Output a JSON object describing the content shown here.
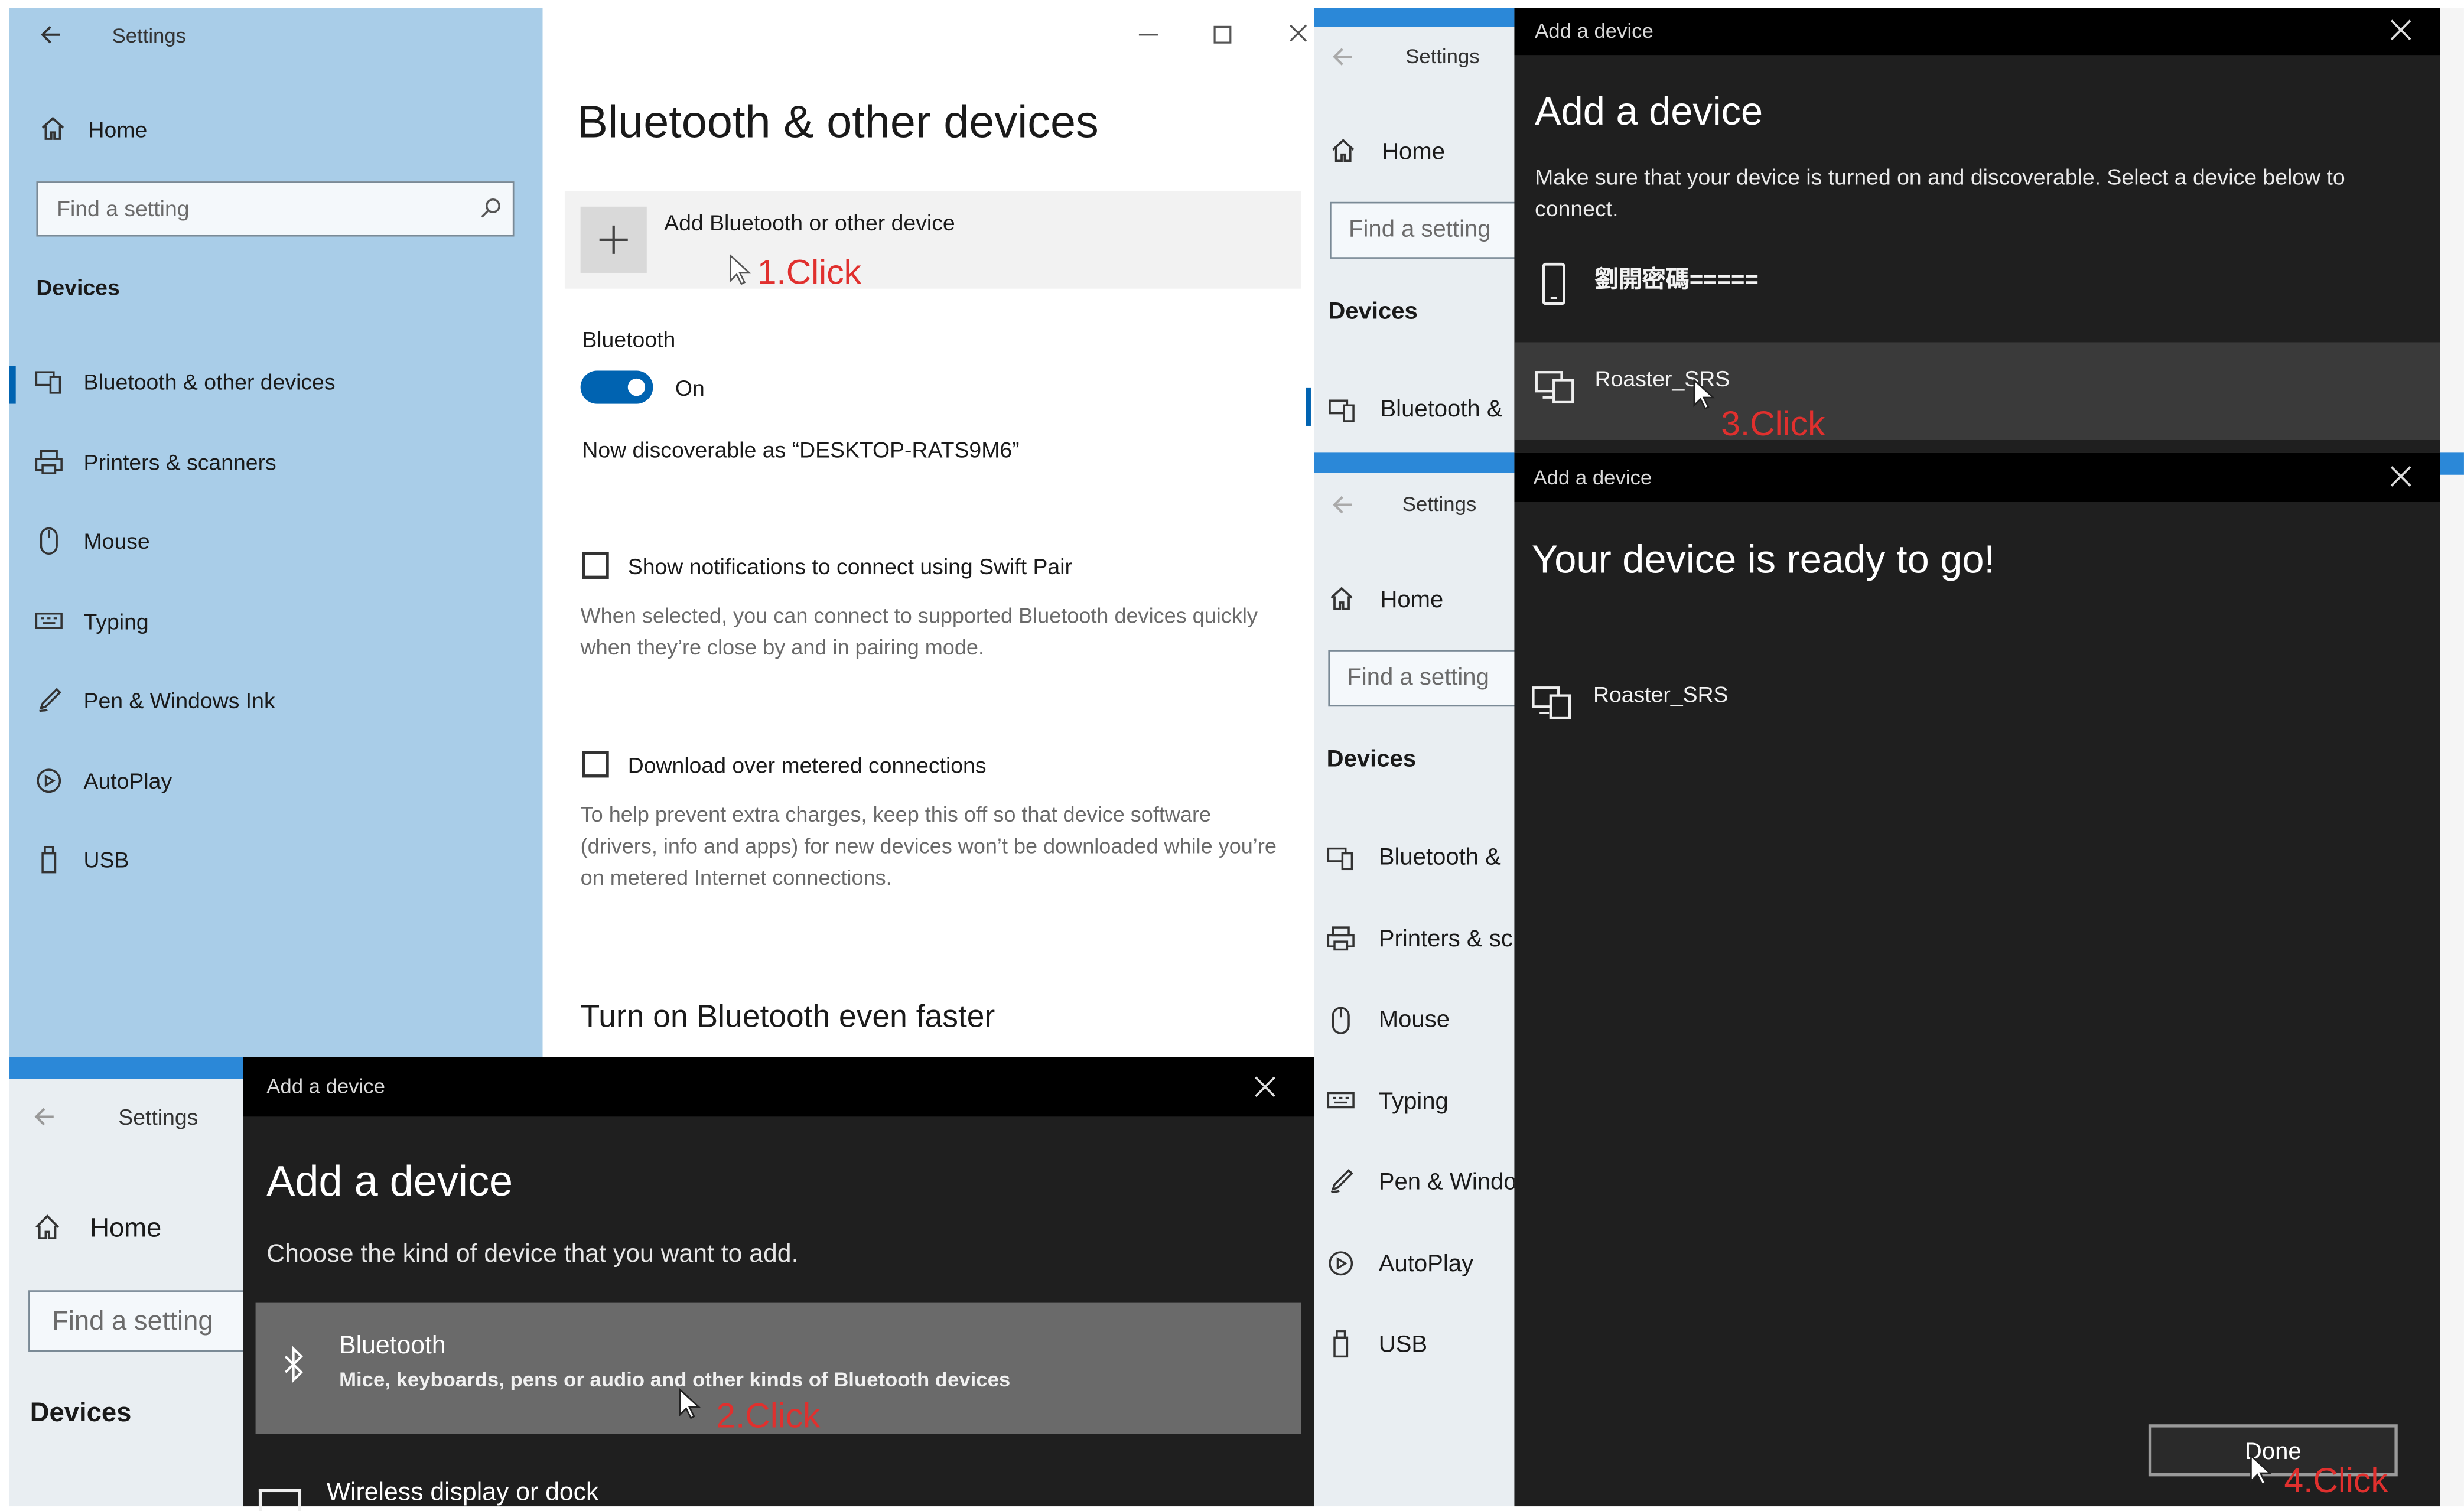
{
  "win1": {
    "title": "Settings",
    "home": "Home",
    "search_placeholder": "Find a setting",
    "section": "Devices",
    "nav": [
      "Bluetooth & other devices",
      "Printers & scanners",
      "Mouse",
      "Typing",
      "Pen & Windows Ink",
      "AutoPlay",
      "USB"
    ],
    "page_title": "Bluetooth & other devices",
    "add_label": "Add Bluetooth or other device",
    "click1": "1.Click",
    "bt_label": "Bluetooth",
    "bt_state": "On",
    "discoverable": "Now discoverable as “DESKTOP-RATS9M6”",
    "swift_label": "Show notifications to connect using Swift Pair",
    "swift_desc": "When selected, you can connect to supported Bluetooth devices quickly when they’re close by and in pairing mode.",
    "metered_label": "Download over metered connections",
    "metered_desc": "To help prevent extra charges, keep this off so that device software (drivers, info and apps) for new devices won’t be downloaded while you’re on metered Internet connections.",
    "faster": "Turn on Bluetooth even faster"
  },
  "win2": {
    "title": "Settings",
    "home": "Home",
    "search_placeholder": "Find a setting",
    "section": "Devices",
    "dialog_title": "Add a device",
    "heading": "Add a device",
    "subtitle": "Choose the kind of device that you want to add.",
    "option1_title": "Bluetooth",
    "option1_desc": "Mice, keyboards, pens or audio and other kinds of Bluetooth devices",
    "click2": "2.Click",
    "option2_title": "Wireless display or dock"
  },
  "win3": {
    "title": "Settings",
    "home": "Home",
    "search_placeholder": "Find a setting",
    "section": "Devices",
    "nav0": "Bluetooth &",
    "dialog_title": "Add a device",
    "heading": "Add a device",
    "desc": "Make sure that your device is turned on and discoverable. Select a device below to connect.",
    "device1": "劉開密碼=====",
    "device2": "Roaster_SRS",
    "click3": "3.Click"
  },
  "win4": {
    "title": "Settings",
    "home": "Home",
    "search_placeholder": "Find a setting",
    "section": "Devices",
    "nav": [
      "Bluetooth &",
      "Printers & sc",
      "Mouse",
      "Typing",
      "Pen & Windo",
      "AutoPlay",
      "USB"
    ],
    "dialog_title": "Add a device",
    "heading": "Your device is ready to go!",
    "device": "Roaster_SRS",
    "done": "Done",
    "click4": "4.Click"
  },
  "colors": {
    "accent": "#0063b1",
    "annotation": "#e0302e",
    "sidebar": "#a9cde8",
    "dark": "#1f1f1f"
  }
}
